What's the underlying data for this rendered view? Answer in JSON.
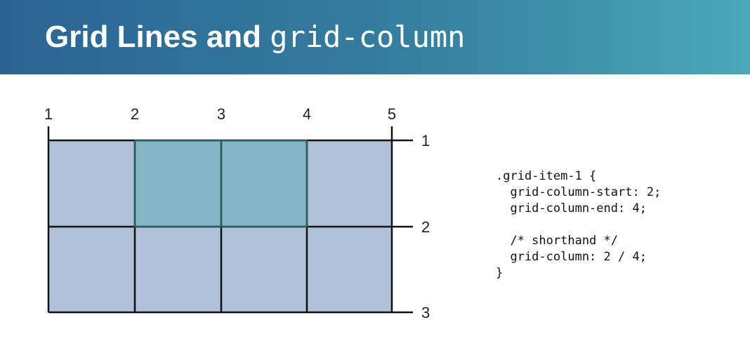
{
  "title": {
    "text": "Grid Lines and ",
    "code": "grid-column"
  },
  "diagram": {
    "column_lines": [
      "1",
      "2",
      "3",
      "4",
      "5"
    ],
    "row_lines": [
      "1",
      "2",
      "3"
    ],
    "highlighted_item": {
      "column_start": 2,
      "column_end": 4,
      "row_start": 1,
      "row_end": 2
    },
    "colors": {
      "cell": "#b1c1da",
      "highlight": "#83b7c8",
      "line": "#111111",
      "highlight_border": "#2f5a5e"
    }
  },
  "code": {
    "lines": [
      ".grid-item-1 {",
      "  grid-column-start: 2;",
      "  grid-column-end: 4;",
      "",
      "  /* shorthand */",
      "  grid-column: 2 / 4;",
      "}"
    ]
  }
}
